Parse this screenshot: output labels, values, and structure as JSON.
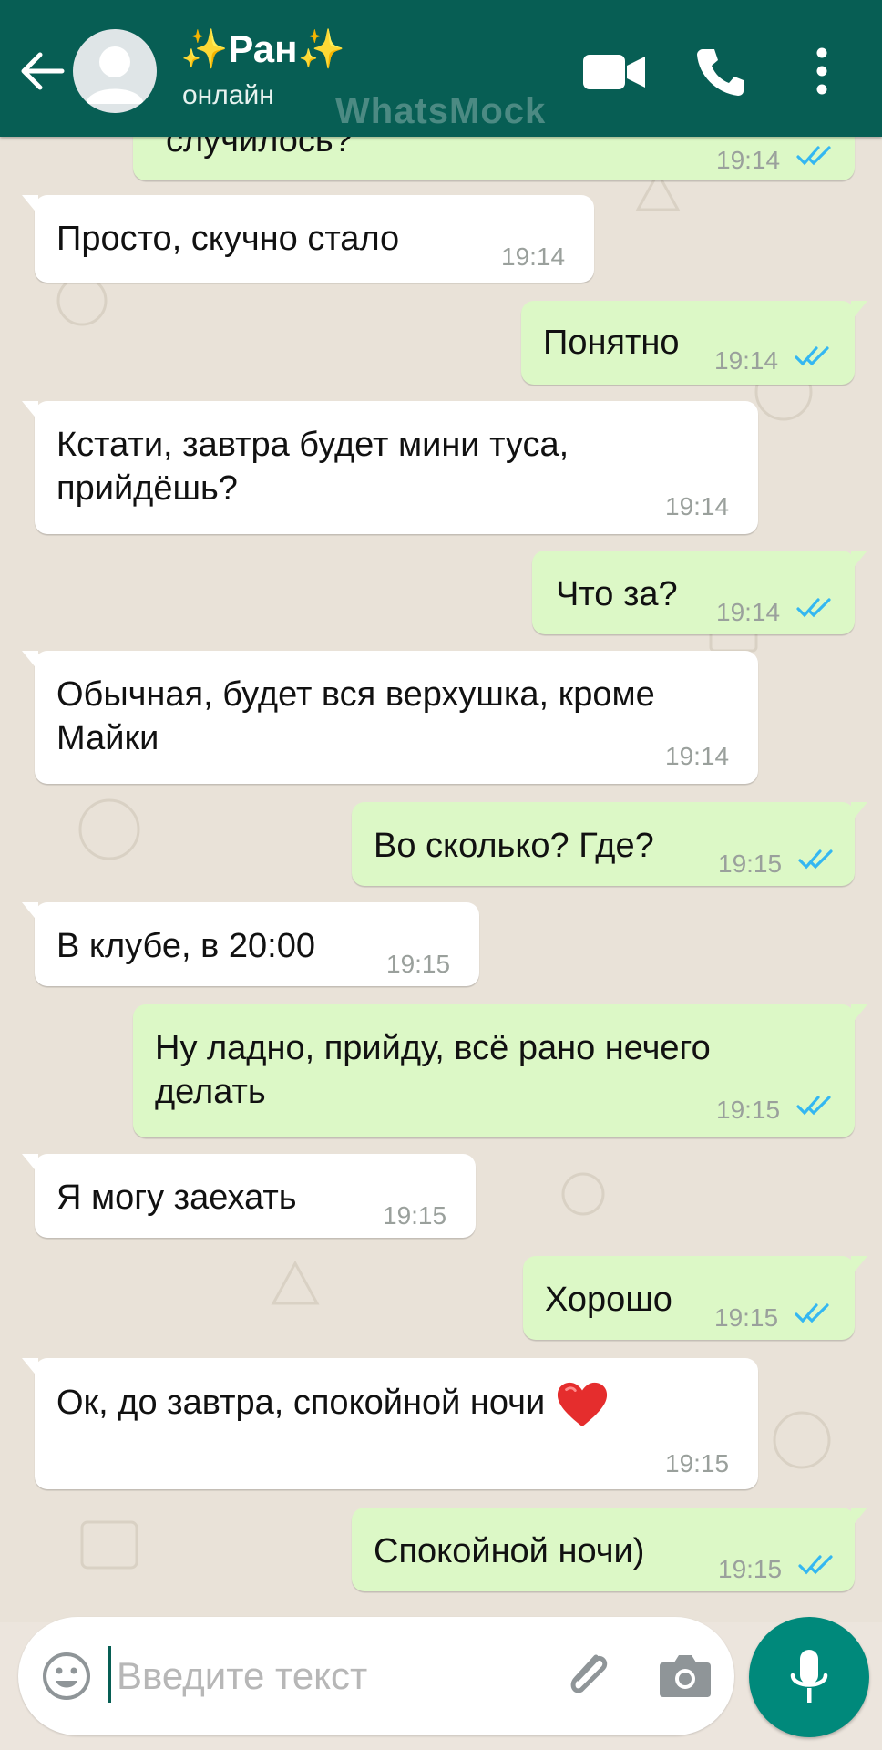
{
  "header": {
    "contact_name": "✨Ран✨",
    "status": "онлайн",
    "watermark": "WhatsMock"
  },
  "messages": [
    {
      "dir": "out",
      "text": "случилось?",
      "time": "19:14",
      "read": true
    },
    {
      "dir": "in",
      "text": "Просто, скучно стало",
      "time": "19:14"
    },
    {
      "dir": "out",
      "text": "Понятно",
      "time": "19:14",
      "read": true
    },
    {
      "dir": "in",
      "lines": [
        "Кстати, завтра будет мини туса,",
        "прийдёшь?"
      ],
      "time": "19:14"
    },
    {
      "dir": "out",
      "text": "Что за?",
      "time": "19:14",
      "read": true
    },
    {
      "dir": "in",
      "lines": [
        "Обычная, будет вся верхушка, кроме",
        "Майки"
      ],
      "time": "19:14"
    },
    {
      "dir": "out",
      "text": "Во сколько? Где?",
      "time": "19:15",
      "read": true
    },
    {
      "dir": "in",
      "text": "В клубе, в 20:00",
      "time": "19:15"
    },
    {
      "dir": "out",
      "lines": [
        "Ну ладно, прийду, всё рано нечего",
        "делать"
      ],
      "time": "19:15",
      "read": true
    },
    {
      "dir": "in",
      "text": "Я могу заехать",
      "time": "19:15"
    },
    {
      "dir": "out",
      "text": "Хорошо",
      "time": "19:15",
      "read": true
    },
    {
      "dir": "in",
      "text": "Ок, до завтра, спокойной ночи",
      "emoji": "heart",
      "time": "19:15"
    },
    {
      "dir": "out",
      "text": "Спокойной ночи)",
      "time": "19:15",
      "read": true
    }
  ],
  "composer": {
    "placeholder": "Введите текст"
  },
  "colors": {
    "header": "#075e54",
    "incoming": "#ffffff",
    "outgoing": "#dcf8c6",
    "read_ticks": "#34b7f1",
    "fab": "#00897b"
  },
  "icons": [
    "back-arrow-icon",
    "avatar-placeholder-icon",
    "video-call-icon",
    "phone-icon",
    "more-vert-icon",
    "emoji-icon",
    "attach-icon",
    "camera-icon",
    "mic-icon"
  ]
}
